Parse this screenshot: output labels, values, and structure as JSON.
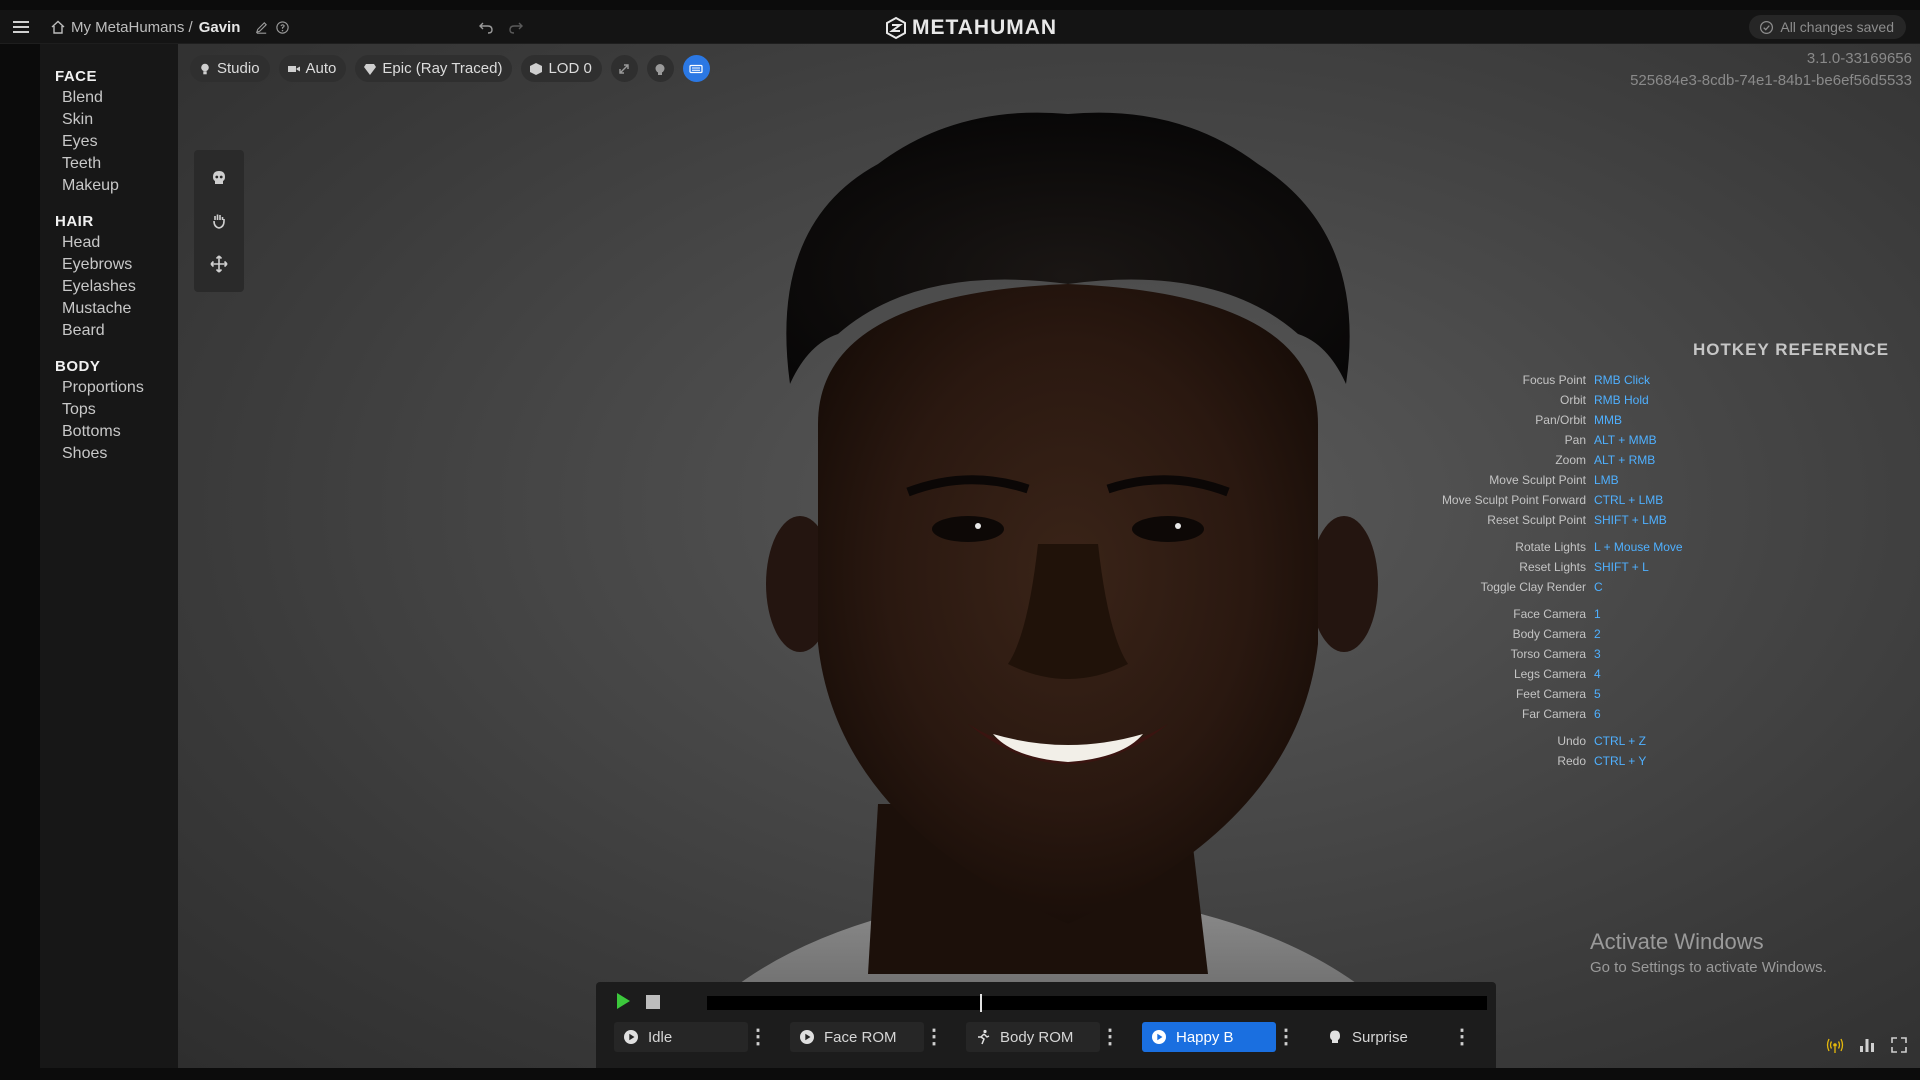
{
  "header": {
    "breadcrumb_root": "My MetaHumans /",
    "breadcrumb_current": "Gavin",
    "logo_text": "METAHUMAN",
    "save_status": "All changes saved"
  },
  "sidebar": {
    "sections": [
      {
        "title": "FACE",
        "items": [
          "Blend",
          "Skin",
          "Eyes",
          "Teeth",
          "Makeup"
        ]
      },
      {
        "title": "HAIR",
        "items": [
          "Head",
          "Eyebrows",
          "Eyelashes",
          "Mustache",
          "Beard"
        ]
      },
      {
        "title": "BODY",
        "items": [
          "Proportions",
          "Tops",
          "Bottoms",
          "Shoes"
        ]
      }
    ]
  },
  "toolbar": {
    "lighting": "Studio",
    "camera": "Auto",
    "quality": "Epic (Ray Traced)",
    "lod": "LOD 0"
  },
  "version": {
    "number": "3.1.0-33169656",
    "id": "525684e3-8cdb-74e1-84b1-be6ef56d5533"
  },
  "hotkeys": {
    "title": "HOTKEY REFERENCE",
    "rows": [
      {
        "action": "Focus Point",
        "key": "RMB Click"
      },
      {
        "action": "Orbit",
        "key": "RMB Hold"
      },
      {
        "action": "Pan/Orbit",
        "key": "MMB"
      },
      {
        "action": "Pan",
        "key": "ALT + MMB"
      },
      {
        "action": "Zoom",
        "key": "ALT + RMB"
      },
      {
        "action": "Move Sculpt Point",
        "key": "LMB"
      },
      {
        "action": "Move Sculpt Point Forward",
        "key": "CTRL + LMB"
      },
      {
        "action": "Reset Sculpt Point",
        "key": "SHIFT + LMB"
      },
      {
        "action": "Rotate Lights",
        "key": "L + Mouse Move"
      },
      {
        "action": "Reset Lights",
        "key": "SHIFT + L"
      },
      {
        "action": "Toggle Clay Render",
        "key": "C"
      },
      {
        "action": "Face Camera",
        "key": "1"
      },
      {
        "action": "Body Camera",
        "key": "2"
      },
      {
        "action": "Torso Camera",
        "key": "3"
      },
      {
        "action": "Legs Camera",
        "key": "4"
      },
      {
        "action": "Feet Camera",
        "key": "5"
      },
      {
        "action": "Far Camera",
        "key": "6"
      },
      {
        "action": "Undo",
        "key": "CTRL + Z"
      },
      {
        "action": "Redo",
        "key": "CTRL + Y"
      }
    ]
  },
  "watermark": {
    "title": "Activate Windows",
    "subtitle": "Go to Settings to activate Windows."
  },
  "player": {
    "playhead_fraction": 0.35,
    "animations": [
      {
        "label": "Idle",
        "icon": "play-circle-icon",
        "selected": false
      },
      {
        "label": "Face ROM",
        "icon": "play-circle-icon",
        "selected": false
      },
      {
        "label": "Body ROM",
        "icon": "running-figure-icon",
        "selected": false
      },
      {
        "label": "Happy B",
        "icon": "play-circle-icon",
        "selected": true
      },
      {
        "label": "Surprise",
        "icon": "face-icon",
        "selected": false
      }
    ]
  },
  "colors": {
    "accent": "#1a6fe0",
    "hotkey_key": "#4fb0ff",
    "play_green": "#3cc83c"
  }
}
